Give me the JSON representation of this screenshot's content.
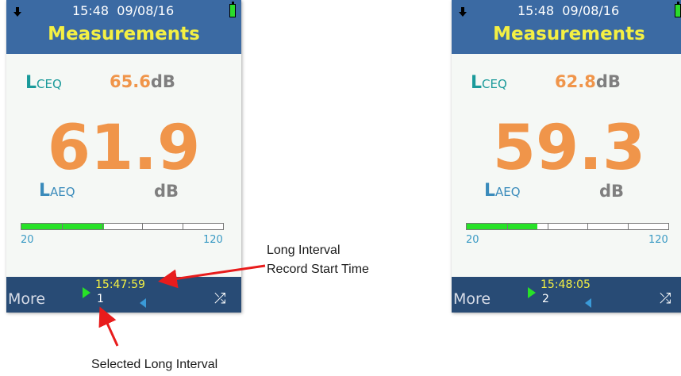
{
  "colors": {
    "header_bg": "#3b6aa3",
    "title": "#f4f043",
    "screen_bg": "#f5f8f5",
    "value_orange": "#f0954a",
    "unit_gray": "#7f7f7f",
    "lceq_teal": "#1a9a9a",
    "laeq_blue": "#3a8bbb",
    "meter_green": "#27e227",
    "footer_bg": "#284b75",
    "record_time": "#f4f043",
    "annotation_arrow": "#e81c1c"
  },
  "screens": [
    {
      "status": {
        "time": "15:48",
        "date": "09/08/16",
        "battery": "full",
        "download_icon": "down-arrow-icon"
      },
      "title": "Measurements",
      "lceq": {
        "label_main": "L",
        "label_sub": "CEQ",
        "value": "65.6",
        "unit": "dB"
      },
      "laeq": {
        "value": "61.9",
        "label_main": "L",
        "label_sub": "AEQ",
        "unit": "dB"
      },
      "meter": {
        "min": "20",
        "max": "120",
        "level_fraction": 0.41
      },
      "footer": {
        "more": "More",
        "record_time": "15:47:59",
        "interval": "1",
        "shuffle_icon": "⤮"
      }
    },
    {
      "status": {
        "time": "15:48",
        "date": "09/08/16",
        "battery": "full",
        "download_icon": "down-arrow-icon"
      },
      "title": "Measurements",
      "lceq": {
        "label_main": "L",
        "label_sub": "CEQ",
        "value": "62.8",
        "unit": "dB"
      },
      "laeq": {
        "value": "59.3",
        "label_main": "L",
        "label_sub": "AEQ",
        "unit": "dB"
      },
      "meter": {
        "min": "20",
        "max": "120",
        "level_fraction": 0.35
      },
      "footer": {
        "more": "More",
        "record_time": "15:48:05",
        "interval": "2",
        "shuffle_icon": "⤮"
      }
    }
  ],
  "annotations": {
    "record_start": [
      "Long Interval",
      "Record Start Time"
    ],
    "selected_interval": "Selected Long Interval"
  }
}
